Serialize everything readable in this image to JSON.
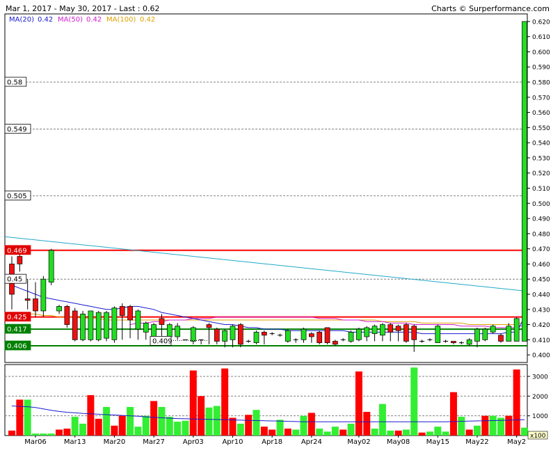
{
  "header": {
    "range_text": "Mar 1, 2017 - May 30, 2017 - Last : 0.62",
    "brand_text": "Charts © Surperformance.com"
  },
  "legend": {
    "items": [
      {
        "label": "MA(20)",
        "value": "0.42",
        "color": "#1a1ad0"
      },
      {
        "label": "MA(50)",
        "value": "0.42",
        "color": "#d020d0"
      },
      {
        "label": "MA(100)",
        "value": "0.42",
        "color": "#e0a000"
      }
    ]
  },
  "chart_data": [
    {
      "type": "candlestick",
      "ylim": [
        0.395,
        0.625
      ],
      "y_ticks": [
        "0.400",
        "0.410",
        "0.420",
        "0.430",
        "0.440",
        "0.450",
        "0.460",
        "0.470",
        "0.480",
        "0.490",
        "0.500",
        "0.510",
        "0.520",
        "0.530",
        "0.540",
        "0.550",
        "0.560",
        "0.570",
        "0.580",
        "0.590",
        "0.600",
        "0.610",
        "0.620"
      ],
      "x_labels": [
        "Mar06",
        "Mar13",
        "Mar20",
        "Mar27",
        "Apr03",
        "Apr10",
        "Apr18",
        "Apr24",
        "May02",
        "May08",
        "May15",
        "May22",
        "May2"
      ],
      "candles": [
        {
          "o": 0.46,
          "c": 0.44,
          "h": 0.465,
          "l": 0.43
        },
        {
          "o": 0.465,
          "c": 0.46,
          "h": 0.467,
          "l": 0.455
        },
        {
          "o": 0.437,
          "c": 0.436,
          "h": 0.45,
          "l": 0.43
        },
        {
          "o": 0.437,
          "c": 0.429,
          "h": 0.448,
          "l": 0.425
        },
        {
          "o": 0.429,
          "c": 0.45,
          "h": 0.452,
          "l": 0.425
        },
        {
          "o": 0.448,
          "c": 0.469,
          "h": 0.47,
          "l": 0.446
        },
        {
          "o": 0.429,
          "c": 0.432,
          "h": 0.433,
          "l": 0.427
        },
        {
          "o": 0.432,
          "c": 0.42,
          "h": 0.433,
          "l": 0.418
        },
        {
          "o": 0.429,
          "c": 0.41,
          "h": 0.431,
          "l": 0.409
        },
        {
          "o": 0.41,
          "c": 0.427,
          "h": 0.429,
          "l": 0.409
        },
        {
          "o": 0.41,
          "c": 0.429,
          "h": 0.429,
          "l": 0.409
        },
        {
          "o": 0.41,
          "c": 0.428,
          "h": 0.429,
          "l": 0.409
        },
        {
          "o": 0.411,
          "c": 0.428,
          "h": 0.429,
          "l": 0.409
        },
        {
          "o": 0.41,
          "c": 0.431,
          "h": 0.432,
          "l": 0.408
        },
        {
          "o": 0.432,
          "c": 0.426,
          "h": 0.434,
          "l": 0.41
        },
        {
          "o": 0.432,
          "c": 0.423,
          "h": 0.433,
          "l": 0.411
        },
        {
          "o": 0.417,
          "c": 0.429,
          "h": 0.43,
          "l": 0.41
        },
        {
          "o": 0.415,
          "c": 0.421,
          "h": 0.422,
          "l": 0.41
        },
        {
          "o": 0.41,
          "c": 0.42,
          "h": 0.421,
          "l": 0.409
        },
        {
          "o": 0.424,
          "c": 0.42,
          "h": 0.427,
          "l": 0.409
        },
        {
          "o": 0.412,
          "c": 0.42,
          "h": 0.421,
          "l": 0.41
        },
        {
          "o": 0.412,
          "c": 0.419,
          "h": 0.421,
          "l": 0.41
        },
        {
          "o": 0.41,
          "c": 0.41,
          "h": 0.41,
          "l": 0.41
        },
        {
          "o": 0.409,
          "c": 0.418,
          "h": 0.419,
          "l": 0.407
        },
        {
          "o": 0.41,
          "c": 0.41,
          "h": 0.41,
          "l": 0.407
        },
        {
          "o": 0.42,
          "c": 0.418,
          "h": 0.421,
          "l": 0.407
        },
        {
          "o": 0.417,
          "c": 0.409,
          "h": 0.418,
          "l": 0.407
        },
        {
          "o": 0.409,
          "c": 0.416,
          "h": 0.417,
          "l": 0.405
        },
        {
          "o": 0.41,
          "c": 0.419,
          "h": 0.42,
          "l": 0.405
        },
        {
          "o": 0.42,
          "c": 0.407,
          "h": 0.421,
          "l": 0.405
        },
        {
          "o": 0.409,
          "c": 0.409,
          "h": 0.41,
          "l": 0.408
        },
        {
          "o": 0.408,
          "c": 0.415,
          "h": 0.416,
          "l": 0.407
        },
        {
          "o": 0.415,
          "c": 0.413,
          "h": 0.416,
          "l": 0.407
        },
        {
          "o": 0.414,
          "c": 0.414,
          "h": 0.415,
          "l": 0.413
        },
        {
          "o": 0.413,
          "c": 0.413,
          "h": 0.414,
          "l": 0.412
        },
        {
          "o": 0.409,
          "c": 0.416,
          "h": 0.417,
          "l": 0.408
        },
        {
          "o": 0.41,
          "c": 0.41,
          "h": 0.411,
          "l": 0.408
        },
        {
          "o": 0.41,
          "c": 0.417,
          "h": 0.418,
          "l": 0.408
        },
        {
          "o": 0.414,
          "c": 0.412,
          "h": 0.415,
          "l": 0.408
        },
        {
          "o": 0.415,
          "c": 0.408,
          "h": 0.416,
          "l": 0.407
        },
        {
          "o": 0.418,
          "c": 0.408,
          "h": 0.418,
          "l": 0.407
        },
        {
          "o": 0.409,
          "c": 0.407,
          "h": 0.41,
          "l": 0.406
        },
        {
          "o": 0.41,
          "c": 0.41,
          "h": 0.411,
          "l": 0.409
        },
        {
          "o": 0.409,
          "c": 0.415,
          "h": 0.416,
          "l": 0.408
        },
        {
          "o": 0.41,
          "c": 0.417,
          "h": 0.418,
          "l": 0.409
        },
        {
          "o": 0.412,
          "c": 0.418,
          "h": 0.419,
          "l": 0.409
        },
        {
          "o": 0.414,
          "c": 0.419,
          "h": 0.42,
          "l": 0.409
        },
        {
          "o": 0.413,
          "c": 0.42,
          "h": 0.421,
          "l": 0.409
        },
        {
          "o": 0.42,
          "c": 0.415,
          "h": 0.421,
          "l": 0.409
        },
        {
          "o": 0.419,
          "c": 0.416,
          "h": 0.42,
          "l": 0.409
        },
        {
          "o": 0.42,
          "c": 0.409,
          "h": 0.421,
          "l": 0.408
        },
        {
          "o": 0.419,
          "c": 0.41,
          "h": 0.42,
          "l": 0.402
        },
        {
          "o": 0.409,
          "c": 0.409,
          "h": 0.41,
          "l": 0.408
        },
        {
          "o": 0.41,
          "c": 0.41,
          "h": 0.411,
          "l": 0.409
        },
        {
          "o": 0.408,
          "c": 0.419,
          "h": 0.42,
          "l": 0.408
        },
        {
          "o": 0.409,
          "c": 0.409,
          "h": 0.41,
          "l": 0.408
        },
        {
          "o": 0.409,
          "c": 0.408,
          "h": 0.409,
          "l": 0.407
        },
        {
          "o": 0.408,
          "c": 0.408,
          "h": 0.409,
          "l": 0.407
        },
        {
          "o": 0.407,
          "c": 0.41,
          "h": 0.411,
          "l": 0.406
        },
        {
          "o": 0.409,
          "c": 0.417,
          "h": 0.418,
          "l": 0.405
        },
        {
          "o": 0.41,
          "c": 0.417,
          "h": 0.418,
          "l": 0.409
        },
        {
          "o": 0.415,
          "c": 0.419,
          "h": 0.42,
          "l": 0.414
        },
        {
          "o": 0.413,
          "c": 0.409,
          "h": 0.414,
          "l": 0.408
        },
        {
          "o": 0.409,
          "c": 0.419,
          "h": 0.421,
          "l": 0.409
        },
        {
          "o": 0.409,
          "c": 0.424,
          "h": 0.425,
          "l": 0.409
        },
        {
          "o": 0.409,
          "c": 0.62,
          "h": 0.62,
          "l": 0.409
        }
      ],
      "horizontal_levels": [
        {
          "label": "0.58",
          "value": 0.58,
          "color": "#808080",
          "style": "dashed",
          "label_bg": "#ffffff",
          "label_color": "#000000"
        },
        {
          "label": "0.549",
          "value": 0.549,
          "color": "#808080",
          "style": "dashed",
          "label_bg": "#ffffff",
          "label_color": "#000000"
        },
        {
          "label": "0.505",
          "value": 0.505,
          "color": "#808080",
          "style": "dashed",
          "label_bg": "#ffffff",
          "label_color": "#000000"
        },
        {
          "label": "0.469",
          "value": 0.469,
          "color": "#ff0000",
          "style": "solid",
          "label_bg": "#e00000",
          "label_color": "#ffffff"
        },
        {
          "label": "0.45",
          "value": 0.45,
          "color": "#808080",
          "style": "dashed",
          "label_bg": "#ffffff",
          "label_color": "#000000"
        },
        {
          "label": "0.425",
          "value": 0.425,
          "color": "#ff0000",
          "style": "solid",
          "label_bg": "#e00000",
          "label_color": "#ffffff"
        },
        {
          "label": "0.417",
          "value": 0.417,
          "color": "#008000",
          "style": "solid",
          "label_bg": "#008000",
          "label_color": "#ffffff"
        },
        {
          "label": "0.406",
          "value": 0.406,
          "color": "#008000",
          "style": "solid",
          "label_bg": "#008000",
          "label_color": "#ffffff"
        }
      ],
      "annotation": {
        "label": "0.409"
      },
      "trendline": {
        "start": 0.478,
        "end": 0.442,
        "color": "#20a8c8"
      },
      "ma20": [
        0.446,
        0.444,
        0.442,
        0.44,
        0.438,
        0.437,
        0.436,
        0.435,
        0.434,
        0.433,
        0.432,
        0.431,
        0.43,
        0.43,
        0.431,
        0.432,
        0.432,
        0.431,
        0.43,
        0.428,
        0.427,
        0.426,
        0.425,
        0.424,
        0.423,
        0.422,
        0.421,
        0.42,
        0.42,
        0.419,
        0.418,
        0.418,
        0.417,
        0.417,
        0.417,
        0.416,
        0.416,
        0.416,
        0.416,
        0.416,
        0.416,
        0.416,
        0.416,
        0.415,
        0.415,
        0.415,
        0.415,
        0.415,
        0.415,
        0.415,
        0.415,
        0.415,
        0.414,
        0.414,
        0.414,
        0.414,
        0.414,
        0.414,
        0.414,
        0.414,
        0.414,
        0.414,
        0.414,
        0.415,
        0.415,
        0.425
      ],
      "ma50": [
        null,
        null,
        null,
        null,
        null,
        null,
        null,
        null,
        null,
        null,
        null,
        null,
        null,
        null,
        null,
        0.42,
        0.421,
        0.421,
        0.422,
        0.422,
        0.423,
        0.423,
        0.423,
        0.424,
        0.424,
        0.424,
        0.425,
        0.425,
        0.425,
        0.425,
        0.425,
        0.425,
        0.425,
        0.425,
        0.425,
        0.425,
        0.425,
        0.425,
        0.425,
        0.424,
        0.424,
        0.424,
        0.423,
        0.423,
        0.423,
        0.422,
        0.422,
        0.422,
        0.421,
        0.421,
        0.421,
        0.42,
        0.42,
        0.42,
        0.42,
        0.42,
        0.42,
        0.419,
        0.419,
        0.419,
        0.419,
        0.418,
        0.418,
        0.418,
        0.418,
        0.42
      ],
      "ma100": [
        0.428,
        0.428,
        0.427,
        0.427,
        0.426,
        0.426,
        0.425,
        0.425,
        0.425,
        0.424,
        0.424,
        0.424,
        0.423,
        0.423,
        0.423,
        0.423,
        0.423,
        0.423,
        0.423,
        0.423,
        0.423,
        0.423,
        0.423,
        0.423,
        0.423,
        0.423,
        0.423,
        0.423,
        0.423,
        0.423,
        0.423,
        0.423,
        0.423,
        0.423,
        0.423,
        0.423,
        0.423,
        0.423,
        0.423,
        0.423,
        0.423,
        0.423,
        0.423,
        0.423,
        0.423,
        0.423,
        0.423,
        0.422,
        0.422,
        0.422,
        0.422,
        0.422,
        0.421,
        0.421,
        0.421,
        0.421,
        0.421,
        0.421,
        0.42,
        0.42,
        0.42,
        0.42,
        0.42,
        0.42,
        0.42,
        0.422
      ]
    },
    {
      "type": "bar",
      "unit_label": "x100",
      "ylim": [
        0,
        3600
      ],
      "y_ticks": [
        "1000",
        "2000",
        "3000"
      ],
      "values": [
        250,
        1820,
        1820,
        100,
        100,
        100,
        300,
        350,
        950,
        600,
        2050,
        850,
        1450,
        500,
        1000,
        1450,
        450,
        1000,
        1750,
        1450,
        950,
        700,
        750,
        3300,
        2000,
        1420,
        1500,
        3400,
        900,
        600,
        1050,
        1300,
        450,
        300,
        800,
        350,
        300,
        1000,
        1150,
        350,
        200,
        450,
        300,
        600,
        3250,
        1200,
        350,
        1600,
        250,
        250,
        300,
        3450,
        150,
        200,
        450,
        200,
        2200,
        950,
        300,
        500,
        1000,
        1000,
        900,
        1000,
        3350,
        400
      ],
      "colors": [
        "R",
        "R",
        "G",
        "G",
        "G",
        "G",
        "R",
        "R",
        "G",
        "G",
        "R",
        "R",
        "G",
        "R",
        "R",
        "G",
        "G",
        "G",
        "R",
        "G",
        "G",
        "G",
        "G",
        "R",
        "R",
        "G",
        "G",
        "R",
        "R",
        "G",
        "R",
        "G",
        "R",
        "R",
        "G",
        "R",
        "G",
        "G",
        "R",
        "G",
        "G",
        "G",
        "R",
        "G",
        "R",
        "R",
        "G",
        "G",
        "G",
        "R",
        "G",
        "G",
        "R",
        "G",
        "G",
        "G",
        "R",
        "G",
        "R",
        "G",
        "R",
        "G",
        "G",
        "R",
        "R",
        "G"
      ],
      "ma": [
        1500,
        1480,
        1460,
        1420,
        1350,
        1280,
        1220,
        1180,
        1150,
        1120,
        1100,
        1080,
        1060,
        1040,
        1020,
        1000,
        980,
        950,
        920,
        900,
        880,
        860,
        850,
        840,
        830,
        820,
        810,
        800,
        790,
        780,
        770,
        760,
        750,
        740,
        730,
        720,
        710,
        700,
        700,
        700,
        700,
        700,
        700,
        700,
        700,
        700,
        700,
        700,
        700,
        700,
        700,
        700,
        700,
        700,
        700,
        700,
        710,
        720,
        730,
        740,
        750,
        760,
        770,
        780,
        790,
        800
      ]
    }
  ]
}
